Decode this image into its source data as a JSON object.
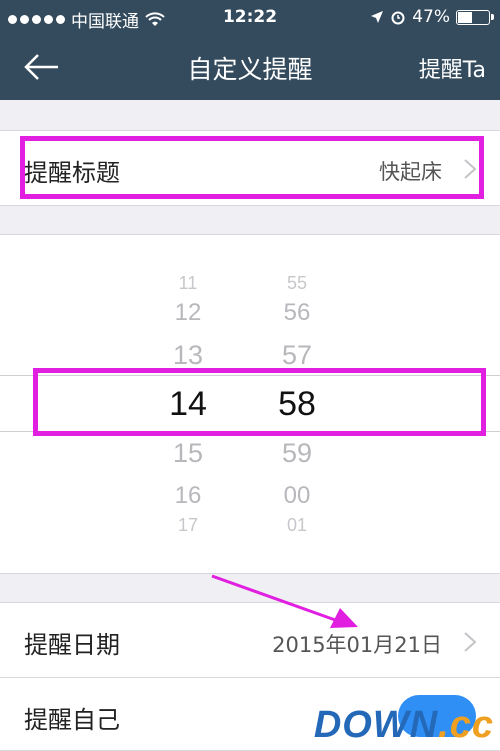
{
  "status_bar": {
    "carrier": "中国联通",
    "time": "12:22",
    "battery": "47%"
  },
  "nav": {
    "title": "自定义提醒",
    "action": "提醒Ta"
  },
  "reminder_title": {
    "label": "提醒标题",
    "value": "快起床"
  },
  "time_picker": {
    "hours": [
      "11",
      "12",
      "13",
      "14",
      "15",
      "16",
      "17"
    ],
    "minutes": [
      "55",
      "56",
      "57",
      "58",
      "59",
      "00",
      "01"
    ],
    "selected_hour": "14",
    "selected_minute": "58"
  },
  "reminder_date": {
    "label": "提醒日期",
    "value": "2015年01月21日"
  },
  "remind_self": {
    "label": "提醒自己",
    "enabled": true
  },
  "watermark": {
    "part1": "DOWN",
    "part2": ".cc"
  },
  "colors": {
    "nav_bg": "#344b5e",
    "highlight": "#e11fe0",
    "toggle_on": "#2f8ff5"
  }
}
